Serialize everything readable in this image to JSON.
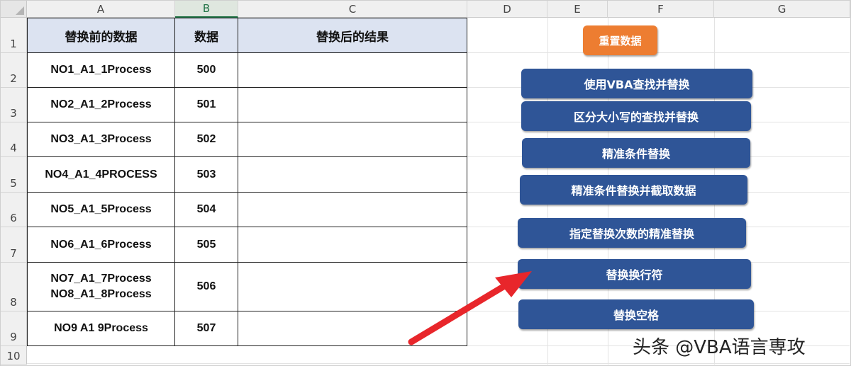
{
  "columns": [
    "A",
    "B",
    "C",
    "D",
    "E",
    "F",
    "G"
  ],
  "rows": [
    "1",
    "2",
    "3",
    "4",
    "5",
    "6",
    "7",
    "8",
    "9",
    "10"
  ],
  "table": {
    "headers": [
      "替换前的数据",
      "数据",
      "替换后的结果"
    ],
    "rows": [
      {
        "original": "NO1_A1_1Process",
        "value": "500",
        "result": ""
      },
      {
        "original": "NO2_A1_2Process",
        "value": "501",
        "result": ""
      },
      {
        "original": "NO3_A1_3Process",
        "value": "502",
        "result": ""
      },
      {
        "original": "NO4_A1_4PROCESS",
        "value": "503",
        "result": ""
      },
      {
        "original": "NO5_A1_5Process",
        "value": "504",
        "result": ""
      },
      {
        "original": "NO6_A1_6Process",
        "value": "505",
        "result": ""
      },
      {
        "original_lines": [
          "NO7_A1_7Process",
          "NO8_A1_8Process"
        ],
        "value": "506",
        "result": ""
      },
      {
        "original": "NO9 A1 9Process",
        "value": "507",
        "result": ""
      }
    ]
  },
  "buttons": {
    "reset": "重置数据",
    "vba_find_replace": "使用VBA查找并替换",
    "case_sensitive": "区分大小写的查找并替换",
    "exact_condition": "精准条件替换",
    "exact_and_extract": "精准条件替换并截取数据",
    "count_limited": "指定替换次数的精准替换",
    "replace_newline": "替换换行符",
    "replace_space": "替换空格"
  },
  "watermark": "头条 @VBA语言専攻",
  "colors": {
    "button_blue": "#2f5597",
    "button_orange": "#ed7d31",
    "header_fill": "#dce3f1",
    "arrow_red": "#e8262b",
    "selected_col_green": "#217346"
  },
  "selected_column": "B"
}
